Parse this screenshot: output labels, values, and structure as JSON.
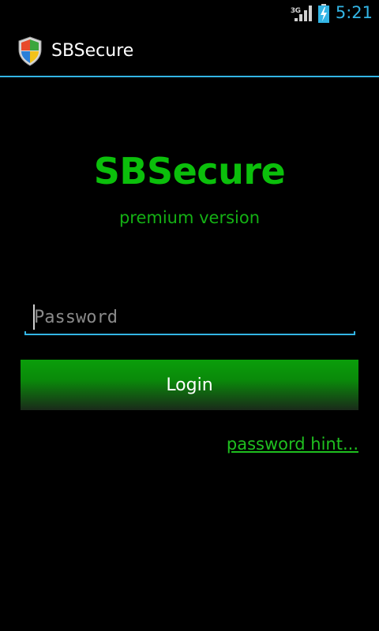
{
  "status_bar": {
    "network_type": "3G",
    "time": "5:21",
    "clock_color": "#33b5e5",
    "icons": [
      "signal-icon",
      "battery-charging-icon"
    ]
  },
  "action_bar": {
    "title": "SBSecure",
    "icon": "shield-icon",
    "divider_color": "#33b5e5"
  },
  "login": {
    "brand_title": "SBSecure",
    "brand_subtitle": "premium version",
    "password_placeholder": "Password",
    "password_value": "",
    "login_label": "Login",
    "hint_link": "password hint..."
  },
  "colors": {
    "brand_green": "#0bbf0b",
    "subtitle_green": "#14b014",
    "link_green": "#1fbf1f",
    "button_top": "#0a9e0a",
    "button_bottom": "#1a2a1a",
    "field_underline": "#33b5e5",
    "background": "#000000"
  }
}
